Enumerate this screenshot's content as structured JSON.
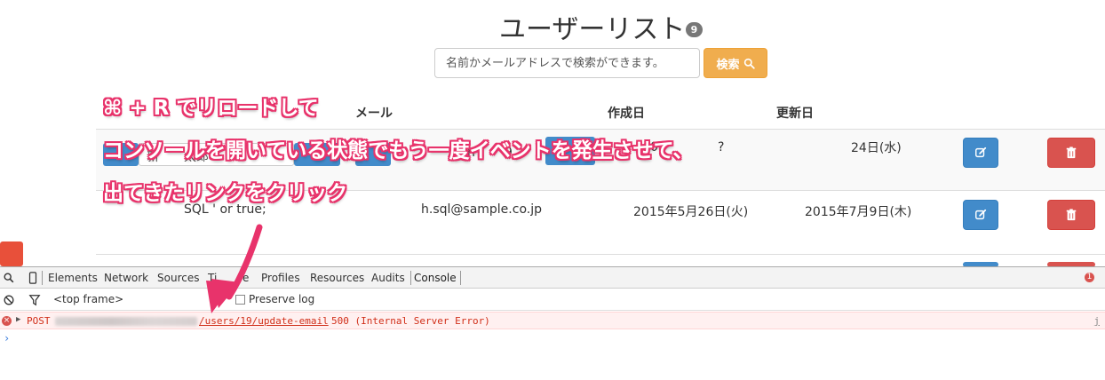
{
  "page": {
    "title": "ユーザーリスト",
    "user_count": "9"
  },
  "search": {
    "placeholder": "名前かメールアドレスで検索ができます。",
    "button_label": "検索",
    "button_icon": "search-icon"
  },
  "table": {
    "headers": {
      "email_partial": "メール",
      "created": "作成日",
      "updated": "更新日"
    },
    "rows": [
      {
        "name_fragment": "新",
        "name_fragment_2": "太郎",
        "email_fragment": "n",
        "email_fragment_2": "9",
        "created_fragment": "0",
        "created_fragment_2": "?",
        "updated_fragment": "24日(水)"
      },
      {
        "name": "SQL ' or true;",
        "email": "h.sql@sample.co.jp",
        "created": "2015年5月26日(火)",
        "updated": "2015年7月9日(木)"
      }
    ],
    "edit_icon": "edit-icon",
    "delete_icon": "trash-icon"
  },
  "annotation": {
    "line1": "⌘ + R でリロードして",
    "line2": "コンソールを開いている状態でもう一度イベントを発生させて、",
    "line3": "出てきたリンクをクリック",
    "color": "#e8336b"
  },
  "devtools": {
    "tabs": [
      "Elements",
      "Network",
      "Sources",
      "Ti",
      "Profiles",
      "Resources",
      "Audits",
      "Console"
    ],
    "tab_fragment_after_arrow": "e",
    "active_tab": "Console",
    "frame_selector": "<top frame>",
    "preserve_log_label": "Preserve log",
    "error_count": "1",
    "error": {
      "method": "POST",
      "url": "/users/19/update-email",
      "status": "500 (Internal Server Error)",
      "source_fragment": "j"
    },
    "prompt": "›"
  }
}
